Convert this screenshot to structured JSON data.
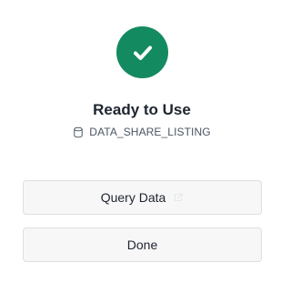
{
  "status": {
    "icon": "check-icon",
    "badge_color": "#138a5f",
    "title": "Ready to Use"
  },
  "listing": {
    "icon": "database-icon",
    "name": "DATA_SHARE_LISTING"
  },
  "actions": {
    "query_label": "Query Data",
    "query_icon": "external-link-icon",
    "done_label": "Done"
  }
}
